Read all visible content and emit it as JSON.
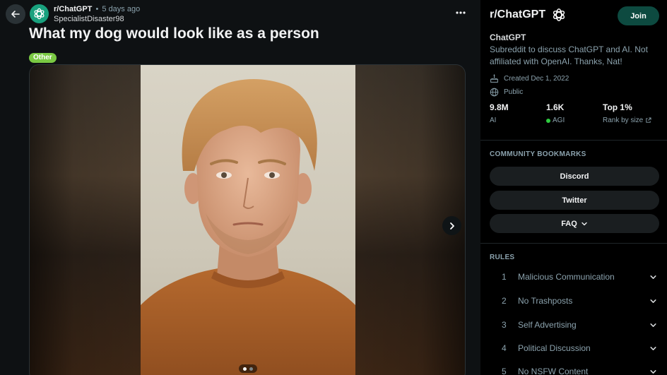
{
  "post": {
    "subreddit": "r/ChatGPT",
    "separator": "•",
    "time": "5 days ago",
    "author": "SpecialistDisaster98",
    "title": "What my dog would look like as a person",
    "flair": "Other",
    "flair_color": "#7ac943",
    "gallery": {
      "current_slide": 1,
      "total_slides": 2
    }
  },
  "icons": {
    "back": "arrow-left-icon",
    "avatar": "openai-logo-icon",
    "more": "more-horizontal-icon",
    "next": "chevron-right-icon"
  },
  "sidebar": {
    "name": "r/ChatGPT",
    "join_label": "Join",
    "title": "ChatGPT",
    "description": "Subreddit to discuss ChatGPT and AI. Not affiliated with OpenAI. Thanks, Nat!",
    "created": "Created Dec 1, 2022",
    "visibility": "Public",
    "stats": [
      {
        "value": "9.8M",
        "label": "AI"
      },
      {
        "value": "1.6K",
        "label": "AGI"
      },
      {
        "value": "Top 1%",
        "label": "Rank by size"
      }
    ],
    "bookmarks_header": "COMMUNITY BOOKMARKS",
    "bookmarks": [
      "Discord",
      "Twitter",
      "FAQ"
    ],
    "rules_header": "RULES",
    "rules": [
      {
        "num": "1",
        "text": "Malicious Communication"
      },
      {
        "num": "2",
        "text": "No Trashposts"
      },
      {
        "num": "3",
        "text": "Self Advertising"
      },
      {
        "num": "4",
        "text": "Political Discussion"
      },
      {
        "num": "5",
        "text": "No NSFW Content"
      }
    ]
  },
  "colors": {
    "background": "#0e1113",
    "sidebar": "#000000",
    "join": "#0d4a40",
    "brand": "#19a17e",
    "online": "#2ecc40"
  }
}
